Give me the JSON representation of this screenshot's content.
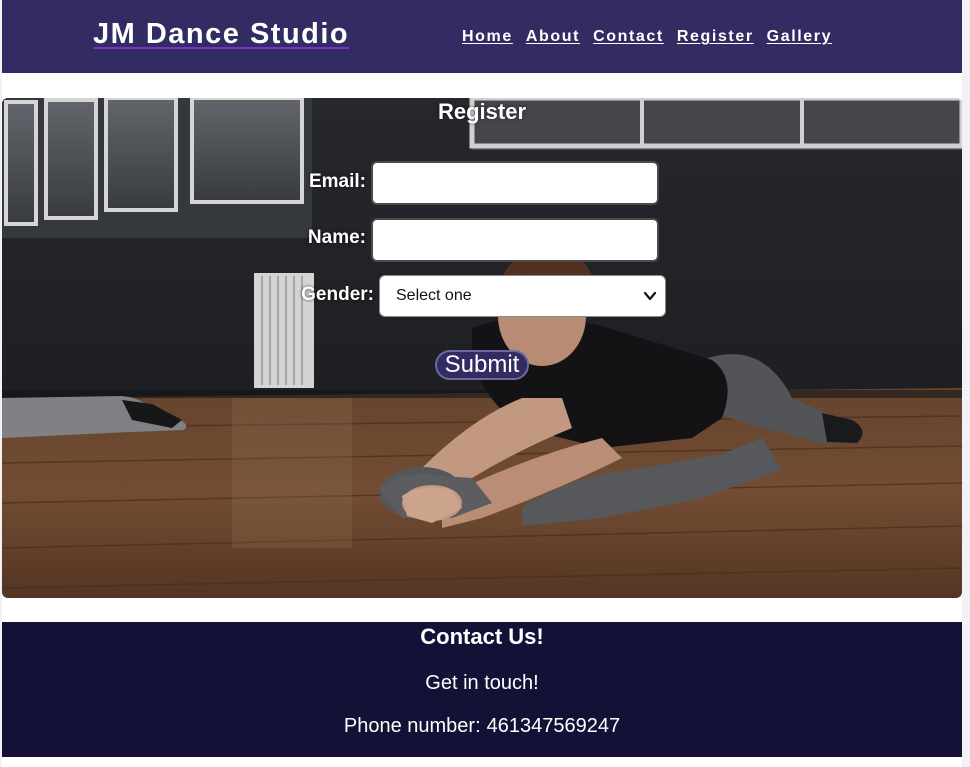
{
  "header": {
    "brand": "JM Dance Studio",
    "nav": [
      "Home",
      "About",
      "Contact",
      "Register",
      "Gallery"
    ]
  },
  "register": {
    "title": "Register",
    "email_label": "Email:",
    "email_value": "",
    "name_label": "Name:",
    "name_value": "",
    "gender_label": "Gender:",
    "gender_selected": "Select one",
    "submit_label": "Submit"
  },
  "footer": {
    "title": "Contact Us!",
    "subtitle": "Get in touch!",
    "phone_label": "Phone number:",
    "phone_value": "461347569247"
  },
  "colors": {
    "header_bg": "#322c62",
    "footer_bg": "#131236",
    "accent": "#7b2fd1"
  },
  "icons": [
    "chevron-down-icon"
  ]
}
